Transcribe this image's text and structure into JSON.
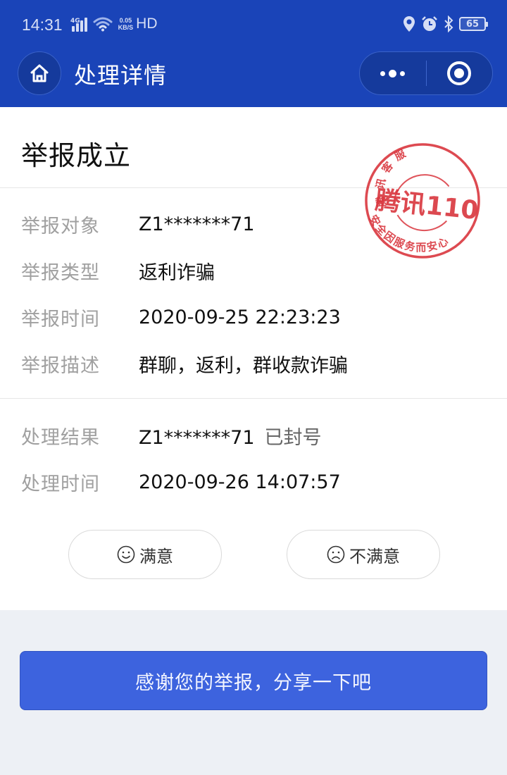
{
  "status_bar": {
    "time": "14:31",
    "network": "4G",
    "speed_value": "0.05",
    "speed_unit": "KB/S",
    "hd": "HD",
    "battery": "65"
  },
  "nav": {
    "title": "处理详情"
  },
  "report": {
    "status_title": "举报成立",
    "stamp": {
      "top_text": "腾讯客服",
      "center_text": "腾讯110",
      "bottom_text": "安全因服务而安心",
      "color": "#d9363e"
    },
    "details": [
      {
        "label": "举报对象",
        "value": "Z1*******71"
      },
      {
        "label": "举报类型",
        "value": "返利诈骗"
      },
      {
        "label": "举报时间",
        "value": "2020-09-25 22:23:23"
      },
      {
        "label": "举报描述",
        "value": "群聊，返利，群收款诈骗"
      }
    ],
    "result": [
      {
        "label": "处理结果",
        "value": "Z1*******71",
        "extra": "已封号"
      },
      {
        "label": "处理时间",
        "value": "2020-09-26 14:07:57"
      }
    ]
  },
  "feedback": {
    "satisfied_label": "满意",
    "unsatisfied_label": "不满意"
  },
  "share": {
    "label": "感谢您的举报，分享一下吧",
    "color": "#3d63de"
  },
  "colors": {
    "header_bg": "#1a44b8",
    "page_bg": "#edf0f5"
  }
}
